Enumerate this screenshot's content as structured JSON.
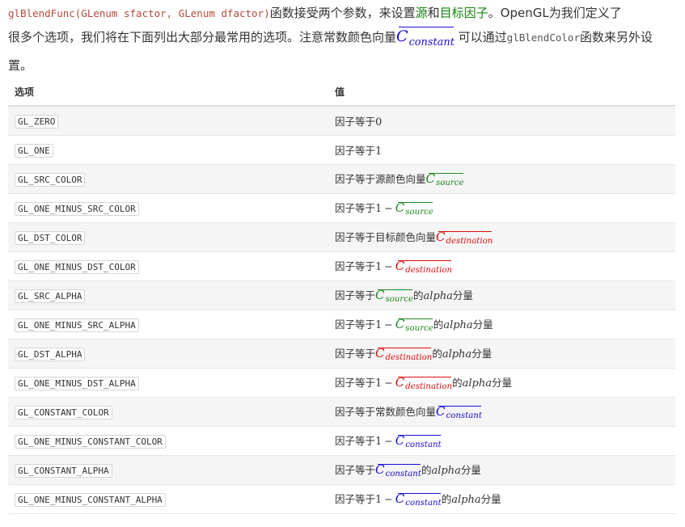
{
  "intro": {
    "func_sig": "glBlendFunc(GLenum sfactor, GLenum dfactor)",
    "t1": "函数接受两个参数，来设置",
    "source_term": "源",
    "t_and": "和",
    "dest_term": "目标因子",
    "t2": "。OpenGL为我们定义了",
    "t3": "很多个选项，我们将在下面列出大部分最常用的选项。注意常数颜色向量",
    "c_letter": "C",
    "c_constant_sub": "constant",
    "t4": " 可以通过",
    "blend_color_fn": "glBlendColor",
    "t5": "函数来另外设",
    "t6": "置。"
  },
  "table": {
    "header_option": "选项",
    "header_value": "值",
    "rows": [
      {
        "option": "GL_ZERO",
        "prefix": "因子等于",
        "num": "0"
      },
      {
        "option": "GL_ONE",
        "prefix": "因子等于",
        "num": "1"
      },
      {
        "option": "GL_SRC_COLOR",
        "prefix": "因子等于源颜色向量",
        "c": "C",
        "sub": "source"
      },
      {
        "option": "GL_ONE_MINUS_SRC_COLOR",
        "prefix": "因子等于",
        "num": "1",
        "minus": "−",
        "c": "C",
        "sub": "source"
      },
      {
        "option": "GL_DST_COLOR",
        "prefix": "因子等于目标颜色向量",
        "c": "C",
        "sub": "destination"
      },
      {
        "option": "GL_ONE_MINUS_DST_COLOR",
        "prefix": "因子等于",
        "num": "1",
        "minus": "−",
        "c": "C",
        "sub": "destination"
      },
      {
        "option": "GL_SRC_ALPHA",
        "prefix": "因子等于",
        "c": "C",
        "sub": "source",
        "of": "的",
        "alpha": "alpha",
        "tail": "分量"
      },
      {
        "option": "GL_ONE_MINUS_SRC_ALPHA",
        "prefix": "因子等于",
        "num": "1",
        "minus": "−",
        "c": "C",
        "sub": "source",
        "of": "的",
        "alpha": "alpha",
        "tail": "分量"
      },
      {
        "option": "GL_DST_ALPHA",
        "prefix": "因子等于",
        "c": "C",
        "sub": "destination",
        "of": "的",
        "alpha": "alpha",
        "tail": "分量"
      },
      {
        "option": "GL_ONE_MINUS_DST_ALPHA",
        "prefix": "因子等于",
        "num": "1",
        "minus": "−",
        "c": "C",
        "sub": "destination",
        "of": "的",
        "alpha": "alpha",
        "tail": "分量"
      },
      {
        "option": "GL_CONSTANT_COLOR",
        "prefix": "因子等于常数颜色向量",
        "c": "C",
        "sub": "constant"
      },
      {
        "option": "GL_ONE_MINUS_CONSTANT_COLOR",
        "prefix": "因子等于",
        "num": "1",
        "minus": "−",
        "c": "C",
        "sub": "constant"
      },
      {
        "option": "GL_CONSTANT_ALPHA",
        "prefix": "因子等于",
        "c": "C",
        "sub": "constant",
        "of": "的",
        "alpha": "alpha",
        "tail": "分量"
      },
      {
        "option": "GL_ONE_MINUS_CONSTANT_ALPHA",
        "prefix": "因子等于",
        "num": "1",
        "minus": "−",
        "c": "C",
        "sub": "constant",
        "of": "的",
        "alpha": "alpha",
        "tail": "分量"
      }
    ]
  },
  "colors": {
    "source": "#1e8a1e",
    "destination": "#d90f0f",
    "constant": "#1a0dd3",
    "code_red": "#b5493d",
    "green_term": "#19850f"
  }
}
